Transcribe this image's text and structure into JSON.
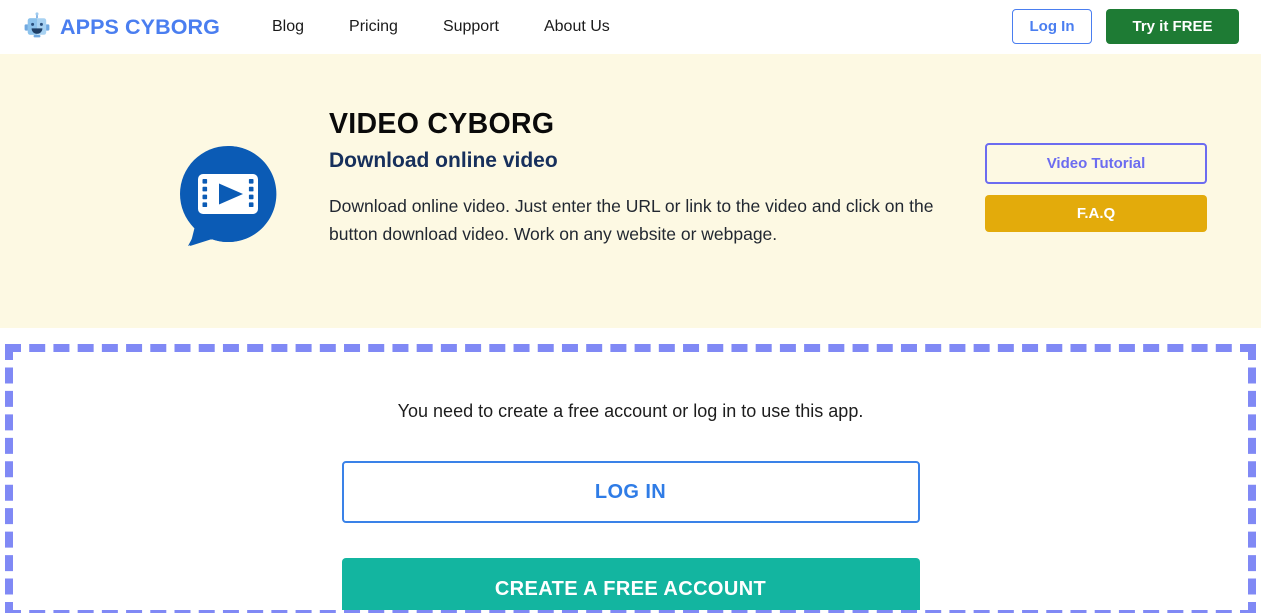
{
  "header": {
    "brand": {
      "icon": "robot-head-icon",
      "text": "APPS CYBORG"
    },
    "nav": [
      {
        "label": "Blog"
      },
      {
        "label": "Pricing"
      },
      {
        "label": "Support"
      },
      {
        "label": "About Us"
      }
    ],
    "login_label": "Log In",
    "try_free_label": "Try it FREE"
  },
  "hero": {
    "icon": "video-speech-bubble-icon",
    "title": "VIDEO CYBORG",
    "subtitle": "Download online video",
    "description": "Download online video. Just enter the URL or link to the video and click on the button download video. Work on any website or webpage.",
    "video_tutorial_label": "Video Tutorial",
    "faq_label": "F.A.Q"
  },
  "auth": {
    "notice": "You need to create a free account or log in to use this app.",
    "log_in_label": "LOG IN",
    "create_account_label": "CREATE A FREE ACCOUNT"
  },
  "colors": {
    "brand_blue": "#4a7ef0",
    "try_free_green": "#1e7b34",
    "hero_background": "#fdf9e3",
    "hero_subtitle_navy": "#17305c",
    "video_icon_blue": "#0b5bb5",
    "tutorial_purple": "#6c6cf0",
    "faq_gold": "#e3ab0b",
    "dashed_border_periwinkle": "#8089f5",
    "login_blue": "#2f7ce6",
    "create_account_teal": "#13b5a0"
  }
}
